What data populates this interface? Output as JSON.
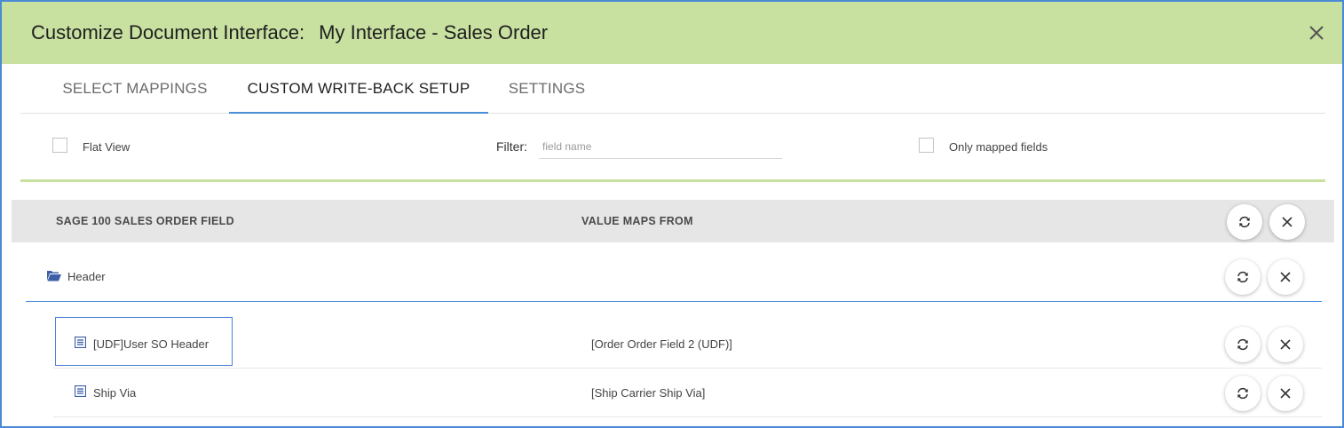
{
  "dialog": {
    "title_prefix": "Customize Document Interface:",
    "title_name": "My Interface - Sales Order"
  },
  "tabs": [
    {
      "label": "SELECT MAPPINGS",
      "active": false
    },
    {
      "label": "CUSTOM WRITE-BACK SETUP",
      "active": true
    },
    {
      "label": "SETTINGS",
      "active": false
    }
  ],
  "filters": {
    "flat_view_label": "Flat View",
    "flat_view_checked": false,
    "filter_label": "Filter:",
    "filter_placeholder": "field name",
    "filter_value": "",
    "only_mapped_label": "Only mapped fields",
    "only_mapped_checked": false
  },
  "grid": {
    "columns": [
      "SAGE 100 SALES ORDER FIELD",
      "VALUE MAPS FROM"
    ],
    "group": {
      "label": "Header",
      "icon": "folder-open-icon"
    },
    "rows": [
      {
        "field": "[UDF]User SO Header",
        "maps_from": "[Order Order Field 2 (UDF)]",
        "icon": "list-icon",
        "selected": true
      },
      {
        "field": "Ship Via",
        "maps_from": "[Ship Carrier Ship Via]",
        "icon": "list-icon",
        "selected": false
      }
    ]
  },
  "colors": {
    "titlebar": "#c8e0a0",
    "accent": "#4a90d9",
    "icon_blue": "#3d5fa8",
    "header_bg": "#e6e6e6"
  }
}
